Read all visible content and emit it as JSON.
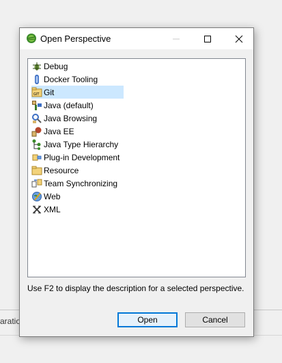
{
  "background": {
    "partial_text": "aratio"
  },
  "dialog": {
    "title": "Open Perspective",
    "perspectives": [
      {
        "label": "Debug",
        "icon": "debug-icon"
      },
      {
        "label": "Docker Tooling",
        "icon": "docker-tooling-icon"
      },
      {
        "label": "Git",
        "icon": "git-icon",
        "selected": true
      },
      {
        "label": "Java (default)",
        "icon": "java-icon"
      },
      {
        "label": "Java Browsing",
        "icon": "java-browsing-icon"
      },
      {
        "label": "Java EE",
        "icon": "java-ee-icon"
      },
      {
        "label": "Java Type Hierarchy",
        "icon": "java-type-hierarchy-icon"
      },
      {
        "label": "Plug-in Development",
        "icon": "plugin-development-icon"
      },
      {
        "label": "Resource",
        "icon": "resource-icon"
      },
      {
        "label": "Team Synchronizing",
        "icon": "team-synchronizing-icon"
      },
      {
        "label": "Web",
        "icon": "web-icon"
      },
      {
        "label": "XML",
        "icon": "xml-icon"
      }
    ],
    "hint": "Use F2 to display the description for a selected perspective.",
    "open_label": "Open",
    "cancel_label": "Cancel"
  },
  "colors": {
    "selection": "#cce8ff",
    "default_button_border": "#0078d7"
  }
}
